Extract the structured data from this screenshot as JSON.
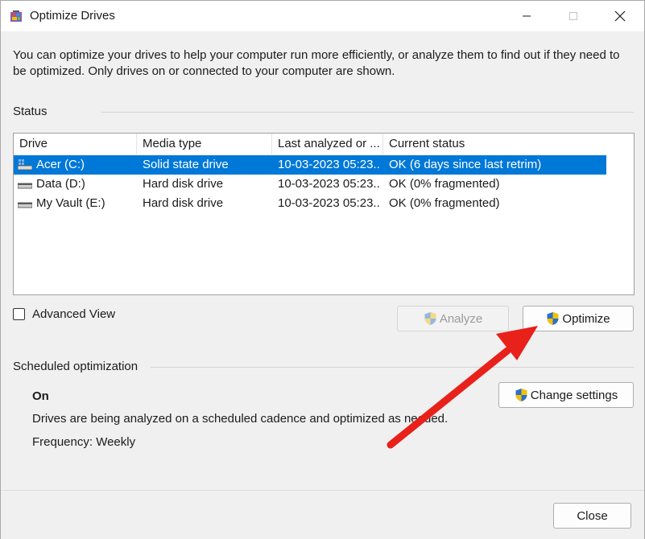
{
  "window": {
    "title": "Optimize Drives",
    "icons": {
      "app": "defrag-app-icon",
      "minimize": "minimize-icon",
      "maximize": "maximize-icon",
      "close": "close-icon"
    }
  },
  "intro_text": "You can optimize your drives to help your computer run more efficiently, or analyze them to find out if they need to be optimized. Only drives on or connected to your computer are shown.",
  "status": {
    "section_label": "Status",
    "columns": [
      "Drive",
      "Media type",
      "Last analyzed or ...",
      "Current status"
    ],
    "drives": [
      {
        "drive": "Acer (C:)",
        "media_type": "Solid state drive",
        "last_analyzed": "10-03-2023 05:23...",
        "current_status": "OK (6 days since last retrim)",
        "selected": true,
        "icon": "system-drive-icon"
      },
      {
        "drive": "Data (D:)",
        "media_type": "Hard disk drive",
        "last_analyzed": "10-03-2023 05:23...",
        "current_status": "OK (0% fragmented)",
        "selected": false,
        "icon": "hard-disk-icon"
      },
      {
        "drive": "My Vault (E:)",
        "media_type": "Hard disk drive",
        "last_analyzed": "10-03-2023 05:23...",
        "current_status": "OK (0% fragmented)",
        "selected": false,
        "icon": "hard-disk-icon"
      }
    ]
  },
  "advanced_view": {
    "label": "Advanced View",
    "checked": false
  },
  "buttons": {
    "analyze": {
      "label": "Analyze",
      "enabled": false,
      "icon": "uac-shield-icon"
    },
    "optimize": {
      "label": "Optimize",
      "enabled": true,
      "icon": "uac-shield-icon"
    },
    "change_settings": {
      "label": "Change settings",
      "enabled": true,
      "icon": "uac-shield-icon"
    },
    "close": {
      "label": "Close",
      "enabled": true
    }
  },
  "scheduled": {
    "section_label": "Scheduled optimization",
    "state": "On",
    "description": "Drives are being analyzed on a scheduled cadence and optimized as needed.",
    "frequency": "Frequency: Weekly"
  },
  "colors": {
    "selection": "#0078d7",
    "annotation_arrow": "#e8211a",
    "shield_blue": "#2a6fc9",
    "shield_yellow": "#f2c200"
  }
}
